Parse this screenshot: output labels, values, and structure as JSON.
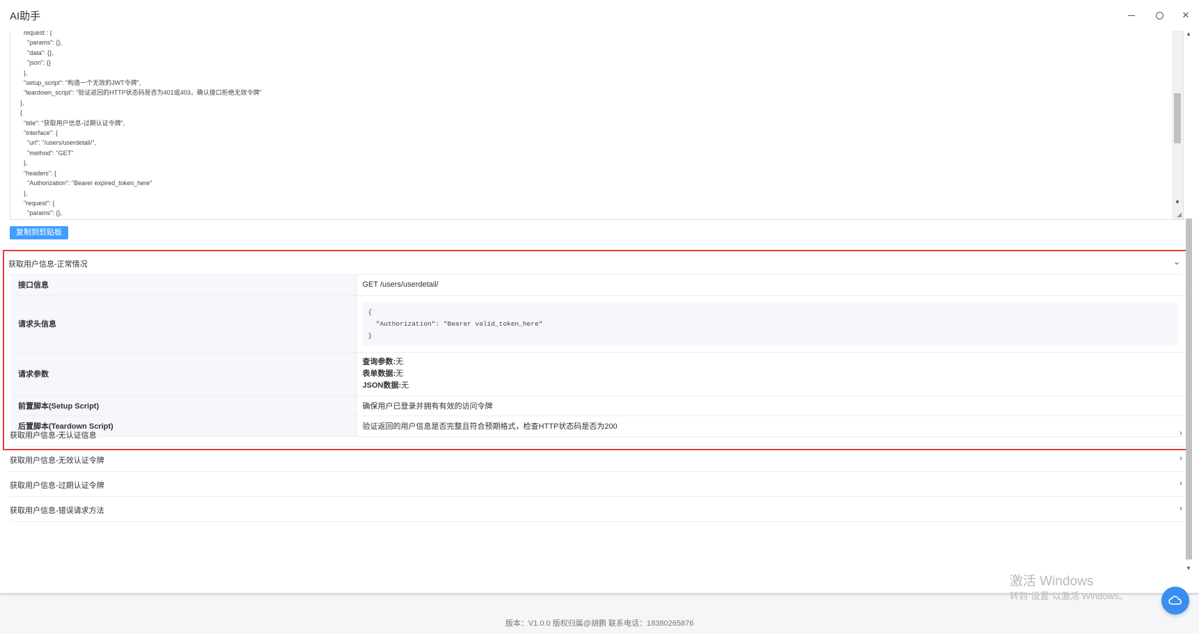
{
  "window": {
    "title": "AI助手",
    "minimize_icon": "minimize-icon",
    "maximize_icon": "maximize-icon",
    "close_symbol": "✕"
  },
  "code_editor": {
    "content": "  request : {\n    \"params\": {},\n    \"data\": {},\n    \"json\": {}\n  },\n  \"setup_script\": \"构造一个无效的JWT令牌\",\n  \"teardown_script\": \"验证返回的HTTP状态码是否为401或403，确认接口拒绝无效令牌\"\n},\n{\n  \"title\": \"获取用户信息-过期认证令牌\",\n  \"interface\": {\n    \"url\": \"/users/userdetail/\",\n    \"method\": \"GET\"\n  },\n  \"headers\": {\n    \"Authorization\": \"Bearer expired_token_here\"\n  },\n  \"request\": {\n    \"params\": {},"
  },
  "copy_button_label": "复制到剪贴板",
  "open_panel": {
    "title": "获取用户信息-正常情况",
    "rows": {
      "interface_label": "接口信息",
      "interface_value": "GET /users/userdetail/",
      "headers_label": "请求头信息",
      "headers_value": "{\n  \"Authorization\": \"Bearer valid_token_here\"\n}",
      "params_label": "请求参数",
      "query_label": "查询参数:",
      "query_value": "无",
      "form_label": "表单数据:",
      "form_value": "无",
      "json_label": "JSON数据:",
      "json_value": "无",
      "setup_label": "前置脚本(Setup Script)",
      "setup_value": "确保用户已登录并拥有有效的访问令牌",
      "teardown_label": "后置脚本(Teardown Script)",
      "teardown_value": "验证返回的用户信息是否完整且符合预期格式，检查HTTP状态码是否为200"
    }
  },
  "closed_panels": [
    "获取用户信息-无认证信息",
    "获取用户信息-无效认证令牌",
    "获取用户信息-过期认证令牌",
    "获取用户信息-错误请求方法"
  ],
  "footer": "版本：V1.0.0 版权归属@胡鹏 联系电话：18380265876",
  "watermark": {
    "line1": "激活 Windows",
    "line2": "转到\"设置\"以激活 Windows。"
  },
  "colors": {
    "primary": "#409eff",
    "highlight_border": "#e53935"
  }
}
